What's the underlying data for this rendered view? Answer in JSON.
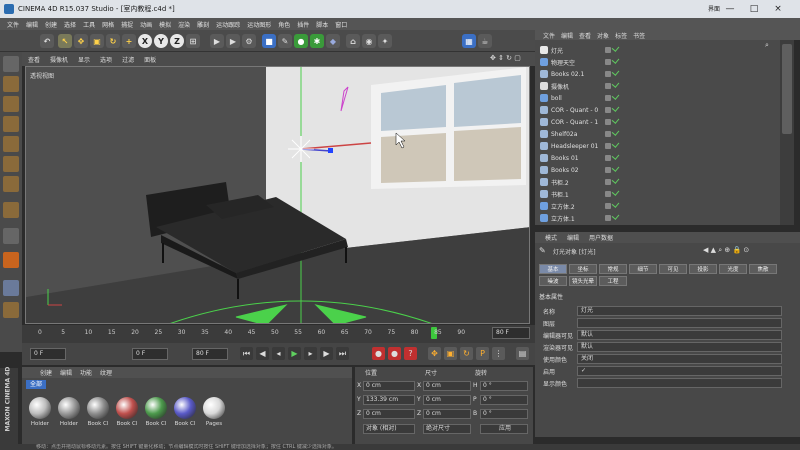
{
  "titlebar": {
    "title": "CINEMA 4D R15.037 Studio - [室内教程.c4d *]",
    "right_label": "界面",
    "min": "—",
    "max": "□",
    "close": "×"
  },
  "menu": [
    "文件",
    "编辑",
    "创建",
    "选择",
    "工具",
    "网格",
    "捕捉",
    "动画",
    "模拟",
    "渲染",
    "雕刻",
    "运动跟踪",
    "运动图形",
    "角色",
    "插件",
    "脚本",
    "窗口"
  ],
  "panel_menu": [
    "文件",
    "编辑",
    "查看",
    "对象",
    "标签",
    "书签"
  ],
  "viewport": {
    "menu": [
      "查看",
      "摄像机",
      "显示",
      "选项",
      "过滤",
      "面板"
    ],
    "label": "透视视图"
  },
  "timeline": {
    "ticks": [
      "0",
      "5",
      "10",
      "15",
      "20",
      "25",
      "30",
      "35",
      "40",
      "45",
      "50",
      "55",
      "60",
      "65",
      "70",
      "75",
      "80",
      "85",
      "90"
    ],
    "end_field": "80 F",
    "current_marker_value": 78,
    "start_frame": "0 F",
    "end_frame": "80 F",
    "playhead": "0 F"
  },
  "materials": {
    "menu": [
      "创建",
      "编辑",
      "功能",
      "纹理"
    ],
    "filter": "全部",
    "items": [
      {
        "label": "Holder",
        "color": "#bdbdbd"
      },
      {
        "label": "Holder",
        "color": "#9a9a9a"
      },
      {
        "label": "Book Cl",
        "color": "#8e8e8e"
      },
      {
        "label": "Book Cl",
        "color": "#c0504d"
      },
      {
        "label": "Book Cl",
        "color": "#4c9a4c"
      },
      {
        "label": "Book Cl",
        "color": "#5a5ac8"
      },
      {
        "label": "Pages",
        "color": "#d9d9d9"
      }
    ]
  },
  "coords": {
    "headers": [
      "位置",
      "尺寸",
      "旋转"
    ],
    "rows": [
      {
        "axis": "X",
        "pos": "0 cm",
        "size": "0 cm",
        "rot_axis": "H",
        "rot": "0 °"
      },
      {
        "axis": "Y",
        "pos": "133.39 cm",
        "size": "0 cm",
        "rot_axis": "P",
        "rot": "0 °"
      },
      {
        "axis": "Z",
        "pos": "0 cm",
        "size": "0 cm",
        "rot_axis": "B",
        "rot": "0 °"
      }
    ],
    "mode1": "对象 (相对)",
    "mode2": "绝对尺寸",
    "apply": "应用"
  },
  "objects": [
    {
      "name": "灯光",
      "icon": "#e8e8e8"
    },
    {
      "name": "物理天空",
      "icon": "#6fa0e0"
    },
    {
      "name": "Books 02.1",
      "icon": "#9fb8d8"
    },
    {
      "name": "摄像机",
      "icon": "#dddddd"
    },
    {
      "name": "boll",
      "icon": "#6fa0e0"
    },
    {
      "name": "COR - Quant - 0",
      "icon": "#9fb8d8"
    },
    {
      "name": "COR - Quant - 1",
      "icon": "#9fb8d8"
    },
    {
      "name": "Shelf02a",
      "icon": "#9fb8d8"
    },
    {
      "name": "Headsleeper 01",
      "icon": "#9fb8d8"
    },
    {
      "name": "Books 01",
      "icon": "#9fb8d8"
    },
    {
      "name": "Books 02",
      "icon": "#9fb8d8"
    },
    {
      "name": "书柜.2",
      "icon": "#9fb8d8"
    },
    {
      "name": "书柜.1",
      "icon": "#9fb8d8"
    },
    {
      "name": "立方体.2",
      "icon": "#6fa0e0"
    },
    {
      "name": "立方体.1",
      "icon": "#6fa0e0"
    }
  ],
  "attr": {
    "menu": [
      "模式",
      "编辑",
      "用户数据"
    ],
    "title": "灯光对象 [灯光]",
    "tabs_row1": [
      "基本",
      "坐标",
      "常规",
      "细节",
      "可见",
      "投影",
      "光度",
      "焦散"
    ],
    "tabs_row2": [
      "噪波",
      "镜头光晕",
      "工程"
    ],
    "section": "基本属性",
    "fields": [
      {
        "label": "名称",
        "value": "灯光"
      },
      {
        "label": "图层",
        "value": ""
      },
      {
        "label": "编辑器可见",
        "value": "默认"
      },
      {
        "label": "渲染器可见",
        "value": "默认"
      },
      {
        "label": "使用颜色",
        "value": "关闭"
      },
      {
        "label": "启用",
        "value": "✓"
      },
      {
        "label": "显示颜色",
        "value": ""
      }
    ]
  },
  "logo_text": "MAXON CINEMA 4D",
  "status": "移动：点击并拖动鼠标移动元素。按住 SHIFT 键量化移动；节点编辑模式时按住 SHIFT 键增加选择对象；按住 CTRL 键减少选择对象。"
}
